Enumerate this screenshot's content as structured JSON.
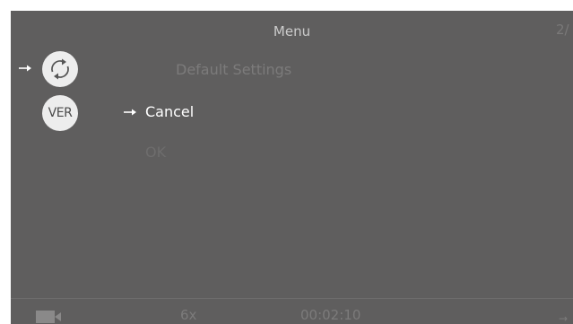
{
  "menu": {
    "title": "Menu",
    "page_indicator": "2/",
    "items": [
      {
        "label": "Default Settings"
      },
      {
        "label": "Cancel"
      },
      {
        "label": "OK"
      }
    ],
    "ver_icon_label": "VER"
  },
  "status_bar": {
    "zoom": "6x",
    "time": "00:02:10"
  },
  "icons": [
    "arrow-right-icon",
    "reset-icon",
    "ver-icon",
    "camera-icon"
  ],
  "colors": {
    "background": "#5f5e5e",
    "selected_text": "#ffffff",
    "dim_text": "#7c7b7b",
    "icon_fill": "#ededed"
  }
}
